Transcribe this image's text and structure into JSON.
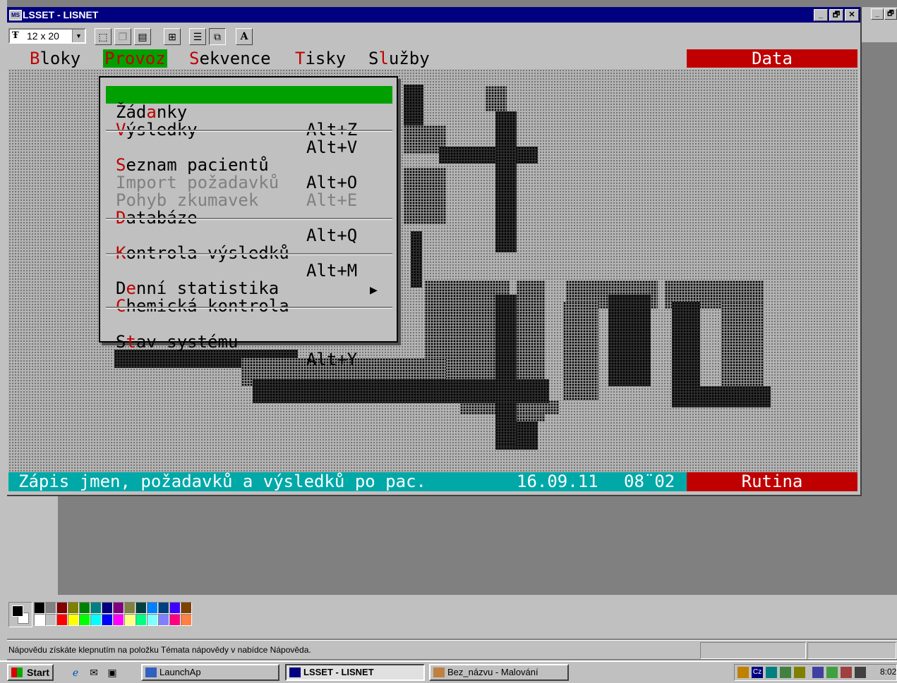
{
  "lsset_window": {
    "title": "LSSET - LISNET",
    "font_size": "12 x 20",
    "font_size_icon": "Ŧ",
    "controls": [
      "_",
      "🗗",
      "✕"
    ]
  },
  "paint_controls": [
    "_",
    "🗗"
  ],
  "toolbar_icons": [
    "select-icon",
    "copy-icon",
    "paste-icon",
    "fullscreen-icon",
    "properties-icon",
    "background-icon",
    "font-icon"
  ],
  "toolbar_font_button": "A",
  "menubar": {
    "items": [
      {
        "hotkey": "B",
        "rest": "loky"
      },
      {
        "hotkey": "P",
        "rest": "rovoz"
      },
      {
        "hotkey": "S",
        "rest": "ekvence"
      },
      {
        "hotkey": "T",
        "rest": "isky"
      },
      {
        "pre": "S",
        "hotkey": "l",
        "rest": "užby"
      }
    ],
    "data_label": "Data"
  },
  "provoz_menu": {
    "items": [
      {
        "pre": "Žád",
        "hotkey": "a",
        "rest": "nky",
        "shortcut": "Alt+Z",
        "selected": true
      },
      {
        "pre": "",
        "hotkey": "V",
        "rest": "ýsledky",
        "shortcut": "Alt+V"
      },
      {
        "pre": "",
        "hotkey": "S",
        "rest": "eznam pacientů",
        "shortcut": "Alt+O"
      },
      {
        "pre": "Import požadavků",
        "hotkey": "",
        "rest": "",
        "shortcut": "Alt+E",
        "disabled": true
      },
      {
        "pre": "Pohyb zkumavek",
        "hotkey": "",
        "rest": "",
        "shortcut": "",
        "disabled": true
      },
      {
        "pre": "",
        "hotkey": "D",
        "rest": "atabáze",
        "shortcut": "Alt+Q"
      },
      {
        "pre": "",
        "hotkey": "K",
        "rest": "ontrola výsledků",
        "shortcut": "Alt+M"
      },
      {
        "pre": "D",
        "hotkey": "e",
        "rest": "nní statistika",
        "shortcut": ""
      },
      {
        "pre": "",
        "hotkey": "C",
        "rest": "hemická kontrola",
        "shortcut": "",
        "submenu_arrow": "▶"
      },
      {
        "pre": "S",
        "hotkey": "t",
        "rest": "av systému",
        "shortcut": "Alt+Y"
      }
    ]
  },
  "terminal_status": {
    "text": "Zápis jmen, požadavků a výsledků po pac.",
    "date": "16.09.11",
    "time": "08¨02",
    "mode": "Rutina"
  },
  "paint_status": {
    "text": "Nápovědu získáte klepnutím na položku Témata nápovědy v nabídce Nápověda."
  },
  "palette": {
    "row1": [
      "#000000",
      "#808080",
      "#800000",
      "#808000",
      "#008000",
      "#008080",
      "#000080",
      "#800080",
      "#808040",
      "#004040",
      "#0080ff",
      "#004080",
      "#4000ff",
      "#804000"
    ],
    "row2": [
      "#ffffff",
      "#c0c0c0",
      "#ff0000",
      "#ffff00",
      "#00ff00",
      "#00ffff",
      "#0000ff",
      "#ff00ff",
      "#ffff80",
      "#00ff80",
      "#80ffff",
      "#8080ff",
      "#ff0080",
      "#ff8040"
    ]
  },
  "taskbar": {
    "start_label": "Start",
    "quick_launch": [
      "ie-icon",
      "outlook-icon",
      "desktop-icon"
    ],
    "tasks": [
      {
        "label": "LaunchAp",
        "active": false
      },
      {
        "label": "LSSET - LISNET",
        "active": true
      },
      {
        "label": "Bez_názvu - Malování",
        "active": false
      }
    ],
    "tray_lang": "Cz",
    "clock": "8:02"
  }
}
